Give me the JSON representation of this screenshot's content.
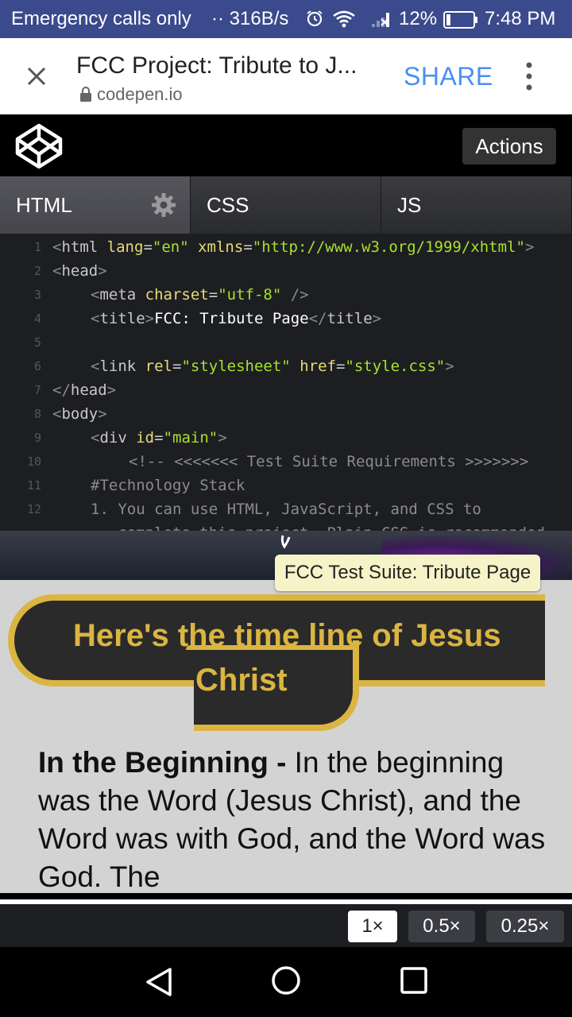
{
  "status_bar": {
    "carrier": "Emergency calls only",
    "speed": "·· 316B/s",
    "battery": "12%",
    "time": "7:48 PM"
  },
  "tab": {
    "title": "FCC Project: Tribute to J...",
    "url": "codepen.io",
    "share": "SHARE"
  },
  "codepen": {
    "actions": "Actions",
    "tabs": [
      "HTML",
      "CSS",
      "JS"
    ]
  },
  "code_lines": [
    {
      "n": "1",
      "indent": 0,
      "html": "<span class=\"br\">&lt;</span><span class=\"tag\">html</span> <span class=\"attr\">lang</span>=<span class=\"val\">\"en\"</span> <span class=\"attr\">xmlns</span>=<span class=\"val\">\"http://www.w3.org/1999/xhtml\"</span><span class=\"br\">&gt;</span>"
    },
    {
      "n": "2",
      "indent": 0,
      "html": "<span class=\"br\">&lt;</span><span class=\"tag\">head</span><span class=\"br\">&gt;</span>"
    },
    {
      "n": "3",
      "indent": 1,
      "html": "<span class=\"br\">&lt;</span><span class=\"tag\">meta</span> <span class=\"attr\">charset</span>=<span class=\"val\">\"utf-8\"</span> <span class=\"br\">/&gt;</span>"
    },
    {
      "n": "4",
      "indent": 1,
      "html": "<span class=\"br\">&lt;</span><span class=\"tag\">title</span><span class=\"br\">&gt;</span><span class=\"txt\">FCC: Tribute Page</span><span class=\"br\">&lt;/</span><span class=\"tag\">title</span><span class=\"br\">&gt;</span>"
    },
    {
      "n": "5",
      "indent": 0,
      "html": ""
    },
    {
      "n": "6",
      "indent": 1,
      "html": "<span class=\"br\">&lt;</span><span class=\"tag\">link</span> <span class=\"attr\">rel</span>=<span class=\"val\">\"stylesheet\"</span> <span class=\"attr\">href</span>=<span class=\"val\">\"style.css\"</span><span class=\"br\">&gt;</span>"
    },
    {
      "n": "7",
      "indent": 0,
      "html": "<span class=\"br\">&lt;/</span><span class=\"tag\">head</span><span class=\"br\">&gt;</span>"
    },
    {
      "n": "8",
      "indent": 0,
      "html": "<span class=\"br\">&lt;</span><span class=\"tag\">body</span><span class=\"br\">&gt;</span>"
    },
    {
      "n": "9",
      "indent": 1,
      "html": "<span class=\"br\">&lt;</span><span class=\"tag\">div</span> <span class=\"attr\">id</span>=<span class=\"val\">\"main\"</span><span class=\"br\">&gt;</span>"
    },
    {
      "n": "10",
      "indent": 2,
      "html": "<span class=\"com\">&lt;!-- &lt;&lt;&lt;&lt;&lt;&lt;&lt; Test Suite Requirements &gt;&gt;&gt;&gt;&gt;&gt;&gt;</span>"
    },
    {
      "n": "11",
      "indent": 1,
      "html": "<span class=\"com\">#Technology Stack</span>"
    },
    {
      "n": "12",
      "indent": 1,
      "html": "<span class=\"com\">1. You can use HTML, JavaScript, and CSS to</span>"
    },
    {
      "n": "",
      "indent": 1,
      "html": "<span class=\"com\">   complete this project. Plain CSS is recommended</span>"
    }
  ],
  "tooltip": "FCC Test Suite: Tribute Page",
  "preview": {
    "heading_line1": "Here's the time line of Jesus",
    "heading_line2": "Christ",
    "para_bold": "In the Beginning -",
    "para_text": " In the beginning was the Word (Jesus Christ), and the Word was with God, and the Word was God. The"
  },
  "zoom": {
    "options": [
      "1×",
      "0.5×",
      "0.25×"
    ],
    "selected": "1×"
  },
  "colors": {
    "status_bar": "#3b4a8c",
    "share": "#4a8ff0",
    "heading_gold": "#dbb541",
    "preview_bg": "#d3d3d3"
  }
}
